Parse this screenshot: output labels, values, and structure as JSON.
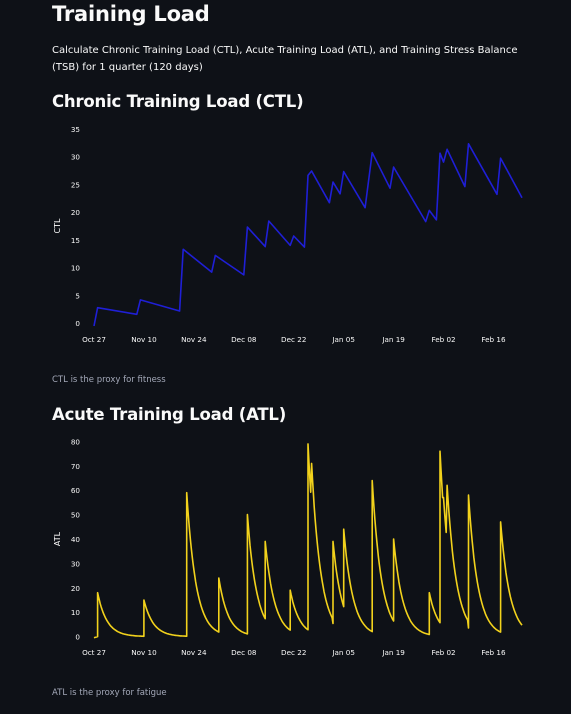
{
  "title": "Training Load",
  "description": "Calculate Chronic Training Load (CTL), Acute Training Load (ATL), and Training Stress Balance (TSB) for 1 quarter (120 days)",
  "ctl_section": {
    "heading": "Chronic Training Load (CTL)",
    "caption": "CTL is the proxy for fitness"
  },
  "atl_section": {
    "heading": "Acute Training Load (ATL)",
    "caption": "ATL is the proxy for fatigue"
  },
  "colors": {
    "background": "#0e1117",
    "ctl_line": "#1f1fd6",
    "atl_line": "#f2d21c",
    "caption": "#a3a8b8"
  },
  "chart_data": [
    {
      "type": "line",
      "title": "",
      "xlabel": "",
      "ylabel": "CTL",
      "x_ticks": [
        "Oct 27",
        "Nov 10",
        "Nov 24",
        "Dec 08",
        "Dec 22",
        "Jan 05",
        "Jan 19",
        "Feb 02",
        "Feb 16"
      ],
      "y_ticks": [
        0,
        5,
        10,
        15,
        20,
        25,
        30,
        35
      ],
      "ylim": [
        -0.5,
        35.5
      ],
      "x_day_range": [
        0,
        120
      ],
      "grid": false,
      "series": [
        {
          "color": "#1f1fd6",
          "points": [
            [
              0,
              -0.5
            ],
            [
              1,
              2.8
            ],
            [
              12,
              1.6
            ],
            [
              13,
              4.2
            ],
            [
              24,
              2.2
            ],
            [
              25,
              13.3
            ],
            [
              33,
              9.2
            ],
            [
              34,
              12.2
            ],
            [
              42,
              8.7
            ],
            [
              43,
              17.3
            ],
            [
              48,
              13.8
            ],
            [
              49,
              18.4
            ],
            [
              55,
              14.0
            ],
            [
              56,
              15.7
            ],
            [
              59,
              13.7
            ],
            [
              60,
              26.6
            ],
            [
              61,
              27.4
            ],
            [
              66,
              21.7
            ],
            [
              67,
              25.4
            ],
            [
              69,
              23.3
            ],
            [
              70,
              27.3
            ],
            [
              76,
              20.8
            ],
            [
              78,
              30.7
            ],
            [
              83,
              24.3
            ],
            [
              84,
              28.1
            ],
            [
              93,
              18.3
            ],
            [
              94,
              20.3
            ],
            [
              96,
              18.6
            ],
            [
              97,
              30.6
            ],
            [
              98,
              29.0
            ],
            [
              99,
              31.3
            ],
            [
              104,
              24.6
            ],
            [
              105,
              32.3
            ],
            [
              113,
              23.2
            ],
            [
              114,
              29.7
            ],
            [
              120,
              22.6
            ]
          ]
        }
      ]
    },
    {
      "type": "line",
      "title": "",
      "xlabel": "",
      "ylabel": "ATL",
      "x_ticks": [
        "Oct 27",
        "Nov 10",
        "Nov 24",
        "Dec 08",
        "Dec 22",
        "Jan 05",
        "Jan 19",
        "Feb 02",
        "Feb 16"
      ],
      "y_ticks": [
        0,
        10,
        20,
        30,
        40,
        50,
        60,
        70,
        80
      ],
      "ylim": [
        -1,
        81
      ],
      "x_day_range": [
        0,
        120
      ],
      "grid": false,
      "series": [
        {
          "color": "#f2d21c",
          "decay_days": 2.6,
          "sessions": [
            {
              "day": 1,
              "peak": 18
            },
            {
              "day": 14,
              "peak": 15
            },
            {
              "day": 26,
              "peak": 59
            },
            {
              "day": 35,
              "peak": 24
            },
            {
              "day": 43,
              "peak": 50
            },
            {
              "day": 48,
              "peak": 39
            },
            {
              "day": 55,
              "peak": 19
            },
            {
              "day": 60,
              "peak": 79
            },
            {
              "day": 67,
              "peak": 39
            },
            {
              "day": 70,
              "peak": 44
            },
            {
              "day": 78,
              "peak": 64
            },
            {
              "day": 84,
              "peak": 40
            },
            {
              "day": 94,
              "peak": 18
            },
            {
              "day": 97,
              "peak": 76
            },
            {
              "day": 105,
              "peak": 58
            },
            {
              "day": 114,
              "peak": 47
            }
          ],
          "extra_peaks": [
            {
              "day": 98,
              "value": 57
            },
            {
              "day": 99,
              "value": 62
            },
            {
              "day": 61,
              "value": 71
            }
          ]
        }
      ]
    }
  ]
}
